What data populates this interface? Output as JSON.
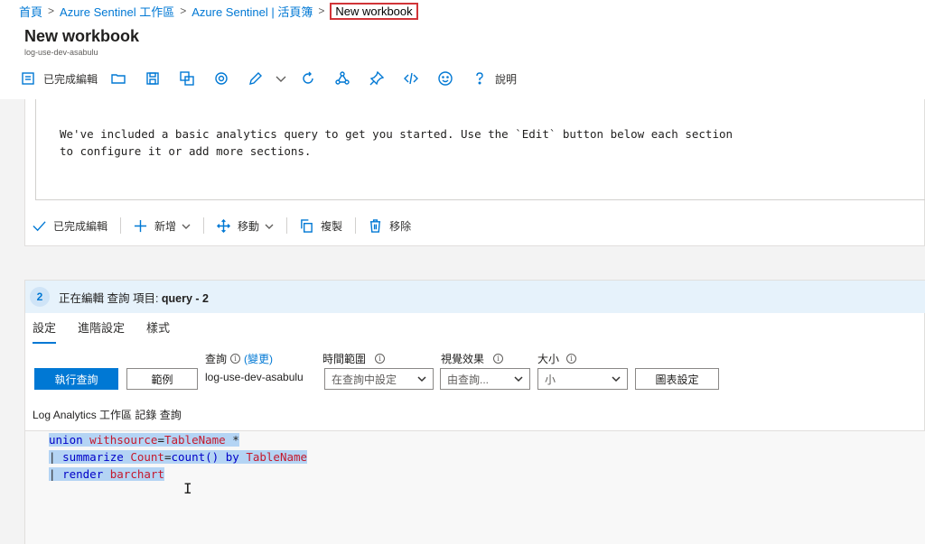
{
  "breadcrumb": {
    "items": [
      "首頁",
      "Azure Sentinel 工作區",
      "Azure Sentinel | 活頁簿"
    ],
    "current": "New workbook"
  },
  "page": {
    "title": "New workbook",
    "subtitle": "log-use-dev-asabulu"
  },
  "toolbar": {
    "done_label": "已完成編輯",
    "help_label": "說明",
    "icons": [
      "done-edit-icon",
      "open-icon",
      "save-icon",
      "save-as-icon",
      "settings-icon",
      "edit-icon",
      "chevron-down-icon",
      "refresh-icon",
      "share-icon",
      "pin-icon",
      "code-icon",
      "feedback-icon",
      "help-icon"
    ]
  },
  "text_section": {
    "line1": "We've included a basic analytics query to get you started. Use the `Edit` button below each section",
    "line2": "to configure it or add more sections."
  },
  "edit_bar": {
    "done": "已完成編輯",
    "add": "新增",
    "move": "移動",
    "clone": "複製",
    "remove": "移除"
  },
  "query_step": {
    "number": "2",
    "header_prefix": "正在編輯 查詢 項目:",
    "header_name": "query - 2",
    "tabs": [
      "設定",
      "進階設定",
      "樣式"
    ],
    "active_tab": "設定",
    "labels": {
      "query": "查詢",
      "change": "(變更)",
      "time_range": "時間範圍",
      "visualization": "視覺效果",
      "size": "大小"
    },
    "run_button": "執行查詢",
    "samples_button": "範例",
    "workspace": "log-use-dev-asabulu",
    "time_range_value": "在查詢中設定",
    "visualization_value": "由查詢...",
    "size_value": "小",
    "chart_settings_button": "圖表設定",
    "editor_label": "Log Analytics 工作區 記錄 查詢"
  },
  "query_code": {
    "line1": {
      "kw1": "union",
      "id1": "withsource",
      "op1": "=",
      "id2": "TableName",
      "op2": " *"
    },
    "line2": {
      "pipe": "| ",
      "kw1": "summarize",
      "id1": "Count",
      "op1": "=",
      "kw2": "count()",
      "kw3": "by",
      "id2": "TableName"
    },
    "line3": {
      "pipe": "| ",
      "kw1": "render",
      "id1": "barchart"
    }
  },
  "colors": {
    "accent": "#0078d4",
    "highlight_red": "#d13438",
    "selection": "#b4d4f4",
    "header_bg": "#e6f2fb"
  }
}
